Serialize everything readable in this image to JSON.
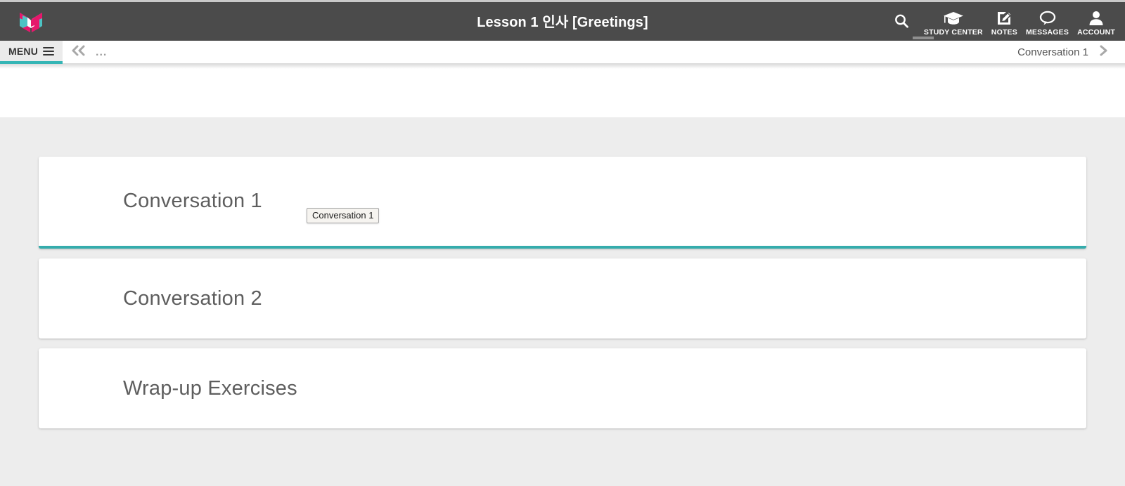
{
  "header": {
    "title": "Lesson 1 인사 [Greetings]",
    "logo_icon": "butterfly-logo-icon",
    "brand_pink": "#e6176b",
    "brand_teal": "#4cc4c4",
    "bar_color": "#4b4b4b",
    "tools": [
      {
        "id": "search",
        "icon": "search-icon",
        "label": ""
      },
      {
        "id": "study-center",
        "icon": "graduation-cap-icon",
        "label": "STUDY CENTER"
      },
      {
        "id": "notes",
        "icon": "pencil-note-icon",
        "label": "NOTES"
      },
      {
        "id": "messages",
        "icon": "speech-bubble-icon",
        "label": "MESSAGES"
      },
      {
        "id": "account",
        "icon": "person-icon",
        "label": "ACCOUNT"
      }
    ]
  },
  "breadcrumb": {
    "menu_label": "MENU",
    "menu_icon": "hamburger-icon",
    "back_icon": "double-chevron-left-icon",
    "ellipsis": "...",
    "current_label": "Conversation 1",
    "next_icon": "chevron-right-icon",
    "accent_color": "#35b5b5"
  },
  "content": {
    "background": "#ededed",
    "cards": [
      {
        "title": "Conversation 1",
        "state": "active",
        "accent": "#35acac"
      },
      {
        "title": "Conversation 2",
        "state": "default",
        "accent": ""
      },
      {
        "title": "Wrap-up Exercises",
        "state": "default",
        "accent": ""
      }
    ],
    "tooltip": {
      "text": "Conversation 1"
    }
  }
}
